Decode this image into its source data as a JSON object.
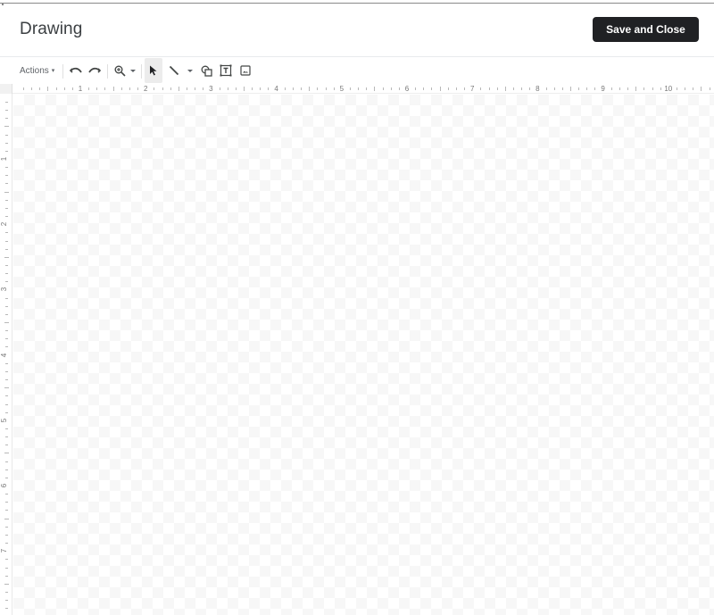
{
  "dialog": {
    "title": "Drawing",
    "save_button_label": "Save and Close"
  },
  "toolbar": {
    "actions_label": "Actions",
    "buttons": [
      {
        "name": "undo",
        "icon": "undo-icon"
      },
      {
        "name": "redo",
        "icon": "redo-icon"
      },
      {
        "name": "zoom",
        "icon": "zoom-in-icon",
        "has_dropdown": true
      },
      {
        "name": "select",
        "icon": "cursor-arrow-icon",
        "active": true
      },
      {
        "name": "line",
        "icon": "line-icon",
        "has_dropdown": true
      },
      {
        "name": "shape",
        "icon": "shape-icon"
      },
      {
        "name": "text-box",
        "icon": "text-box-icon"
      },
      {
        "name": "image",
        "icon": "image-icon"
      }
    ]
  },
  "rulers": {
    "horizontal_labels": [
      "1",
      "2",
      "3",
      "4",
      "5",
      "6",
      "7",
      "8",
      "9",
      "10"
    ],
    "vertical_labels": [
      "1",
      "2",
      "3",
      "4",
      "5",
      "6",
      "7"
    ]
  },
  "colors": {
    "primary_button_bg": "#202124",
    "primary_button_text": "#ffffff",
    "active_tool_bg": "#ececec",
    "canvas_checker": "#f7f7f7"
  }
}
